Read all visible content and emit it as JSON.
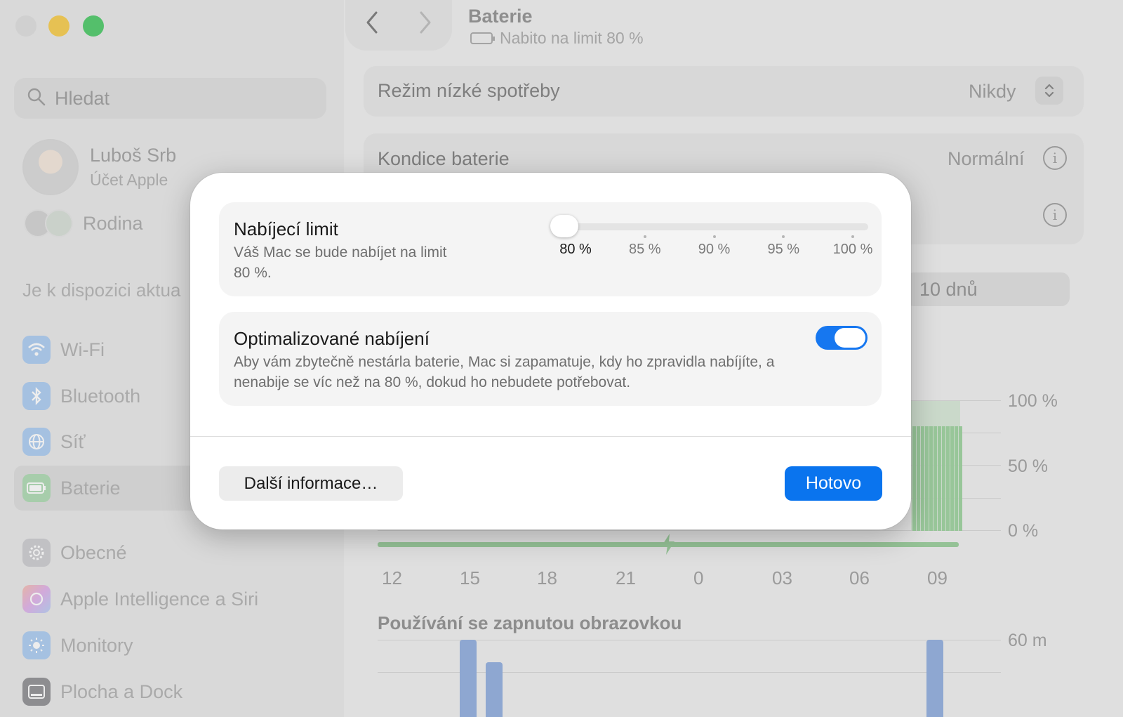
{
  "window": {
    "title": "Baterie",
    "subtitle": "Nabito na limit 80 %"
  },
  "sidebar": {
    "search_placeholder": "Hledat",
    "profile": {
      "name": "Luboš Srb",
      "subtitle": "Účet Apple"
    },
    "family": "Rodina",
    "update_notice": "Je k dispozici aktua",
    "items": [
      {
        "label": "Wi-Fi",
        "icon": "wifi-icon",
        "color": "#3b8ef0"
      },
      {
        "label": "Bluetooth",
        "icon": "bluetooth-icon",
        "color": "#3b8ef0"
      },
      {
        "label": "Síť",
        "icon": "globe-icon",
        "color": "#3b8ef0"
      },
      {
        "label": "Baterie",
        "icon": "battery-icon",
        "color": "#34c759",
        "active": true
      },
      {
        "label": "Obecné",
        "icon": "gear-icon",
        "color": "#8e8e93"
      },
      {
        "label": "Apple Intelligence a Siri",
        "icon": "siri-icon",
        "color": "#e96b8a"
      },
      {
        "label": "Monitory",
        "icon": "sun-icon",
        "color": "#3b8ef0"
      },
      {
        "label": "Plocha a Dock",
        "icon": "dock-icon",
        "color": "#2c2c2e"
      }
    ]
  },
  "settings": {
    "low_power": {
      "label": "Režim nízké spotřeby",
      "value": "Nikdy"
    },
    "health": {
      "label": "Kondice baterie",
      "value": "Normální"
    },
    "range_pill": "10 dnů",
    "level_chart": {
      "y_ticks": [
        "100 %",
        "50 %",
        "0 %"
      ],
      "x_ticks": [
        "12",
        "15",
        "18",
        "21",
        "0",
        "03",
        "06",
        "09"
      ]
    },
    "usage_title": "Používání se zapnutou obrazovkou",
    "usage_y_tick": "60 m"
  },
  "modal": {
    "charge_limit": {
      "title": "Nabíjecí limit",
      "description": "Váš Mac se bude nabíjet na limit 80 %.",
      "options": [
        "80 %",
        "85 %",
        "90 %",
        "95 %",
        "100 %"
      ],
      "selected": "80 %",
      "selected_index": 0
    },
    "optimized": {
      "title": "Optimalizované nabíjení",
      "description": "Aby vám zbytečně nestárla baterie, Mac si zapamatuje, kdy ho zpravidla nabíjíte, a nenabije se víc než na 80 %, dokud ho nebudete potřebovat.",
      "enabled": true
    },
    "more_button": "Další informace…",
    "done_button": "Hotovo",
    "accent_color": "#0a74ee"
  }
}
